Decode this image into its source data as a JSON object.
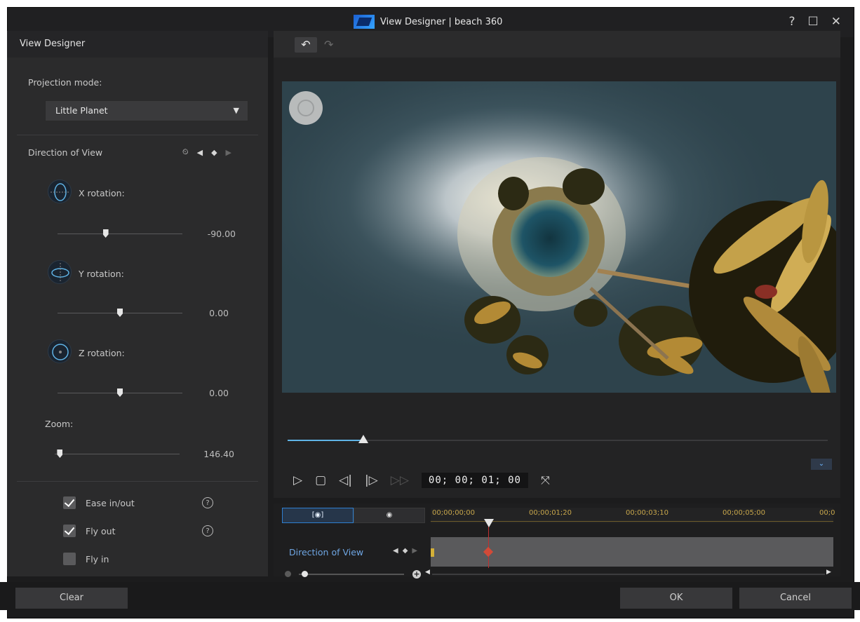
{
  "window": {
    "title": "View Designer  |  beach 360",
    "help_glyph": "?",
    "maximize_glyph": "☐",
    "close_glyph": "✕"
  },
  "left_panel": {
    "header": "View Designer",
    "projection_label": "Projection mode:",
    "projection_value": "Little Planet",
    "direction_label": "Direction of View",
    "x_rotation": {
      "label": "X rotation:",
      "value": "-90.00",
      "position": 0.38
    },
    "y_rotation": {
      "label": "Y rotation:",
      "value": "0.00",
      "position": 0.5
    },
    "z_rotation": {
      "label": "Z rotation:",
      "value": "0.00",
      "position": 0.5
    },
    "zoom": {
      "label": "Zoom:",
      "value": "146.40",
      "position": 0.02
    },
    "checkboxes": [
      {
        "label": "Ease in/out",
        "checked": true
      },
      {
        "label": "Fly out",
        "checked": true
      },
      {
        "label": "Fly in",
        "checked": false
      }
    ]
  },
  "player": {
    "timecode": "00; 00; 01; 00",
    "progress": 0.14
  },
  "timeline": {
    "ticks": [
      "00;00;00;00",
      "00;00;01;20",
      "00;00;03;10",
      "00;00;05;00",
      "00;0"
    ],
    "track_label": "Direction of View"
  },
  "footer": {
    "clear": "Clear",
    "ok": "OK",
    "cancel": "Cancel"
  }
}
